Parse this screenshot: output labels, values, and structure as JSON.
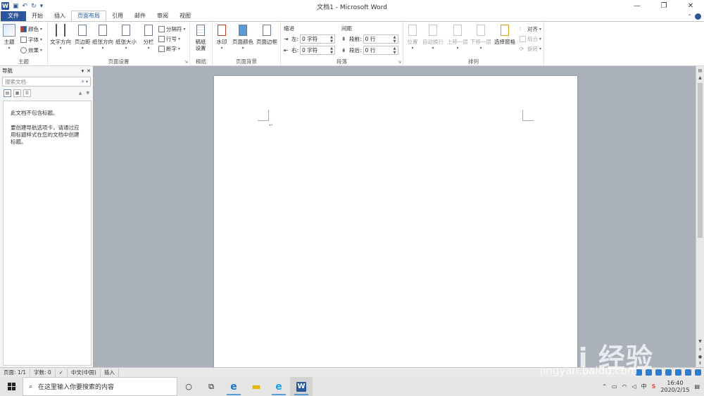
{
  "window": {
    "title": "文档1 - Microsoft Word",
    "controls": [
      "—",
      "❐",
      "✕"
    ]
  },
  "tabs": [
    {
      "label": "文件"
    },
    {
      "label": "开始"
    },
    {
      "label": "插入"
    },
    {
      "label": "页面布局"
    },
    {
      "label": "引用"
    },
    {
      "label": "邮件"
    },
    {
      "label": "审阅"
    },
    {
      "label": "视图"
    }
  ],
  "active_tab": "页面布局",
  "ribbon": {
    "theme": {
      "group_label": "主题",
      "theme_btn": "主题",
      "colors": "颜色",
      "fonts": "字体",
      "effects": "效果"
    },
    "page_setup": {
      "group_label": "页面设置",
      "text_direction": "文字方向",
      "margins": "页边距",
      "orientation": "纸张方向",
      "size": "纸张大小",
      "columns": "分栏",
      "breaks": "分隔符",
      "line_numbers": "行号",
      "hyphenation": "断字"
    },
    "draft": {
      "group_label": "稿纸",
      "draft_settings_1": "稿纸",
      "draft_settings_2": "设置"
    },
    "page_background": {
      "group_label": "页面背景",
      "watermark": "水印",
      "page_color": "页面颜色",
      "page_borders": "页面边框"
    },
    "paragraph": {
      "group_label": "段落",
      "indent_label": "缩进",
      "spacing_label": "间距",
      "left_label": "左:",
      "right_label": "右:",
      "before_label": "段前:",
      "after_label": "段后:",
      "left_value": "0 字符",
      "right_value": "0 字符",
      "before_value": "0 行",
      "after_value": "0 行"
    },
    "arrange": {
      "group_label": "排列",
      "position": "位置",
      "wrap": "自动换行",
      "bring_forward": "上移一层",
      "send_backward": "下移一层",
      "selection_pane": "选择窗格",
      "align": "对齐",
      "group": "组合",
      "rotate": "旋转"
    }
  },
  "nav": {
    "title": "导航",
    "search_placeholder": "搜索文档",
    "msg1": "此文档不包含标题。",
    "msg2": "要创建导航选项卡，请通过应用标题样式在您的文档中创建标题。"
  },
  "status": {
    "page": "页面: 1/1",
    "words": "字数: 0",
    "language": "中文(中国)",
    "mode": "插入"
  },
  "watermark_overlay": {
    "main": "Bai 经验",
    "sub": "jingyan.baidu.com"
  },
  "taskbar": {
    "search_placeholder": "在这里输入你要搜索的内容",
    "time": "16:40",
    "date": "2020/2/15",
    "ime": "中"
  },
  "colors": {
    "accent": "#2b579a",
    "doc_bg": "#abb1bb"
  }
}
